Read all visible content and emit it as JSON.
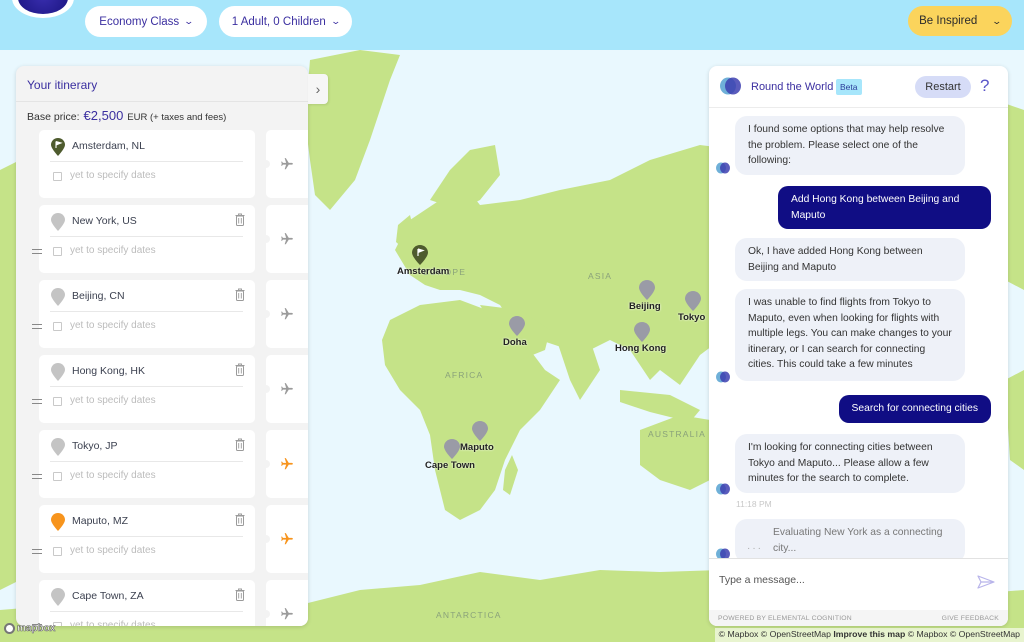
{
  "header": {
    "cabin_class": "Economy Class",
    "passengers": "1 Adult, 0 Children",
    "inspire_label": "Be Inspired"
  },
  "itinerary": {
    "title": "Your itinerary",
    "price_label": "Base price:",
    "price_amount": "€2,500",
    "price_suffix": "EUR (+ taxes and fees)",
    "toggle_icon": "chevron-right-icon",
    "stops": [
      {
        "city": "Amsterdam, NL",
        "dates": "yet to specify dates",
        "pin": "origin-flag",
        "pin_color": "#4e5b2e",
        "deletable": false,
        "leg_color": "#9b9b9b"
      },
      {
        "city": "New York, US",
        "dates": "yet to specify dates",
        "pin": "default",
        "pin_color": "#c4c4c4",
        "deletable": true,
        "leg_color": "#9b9b9b"
      },
      {
        "city": "Beijing, CN",
        "dates": "yet to specify dates",
        "pin": "default",
        "pin_color": "#c4c4c4",
        "deletable": true,
        "leg_color": "#9b9b9b"
      },
      {
        "city": "Hong Kong, HK",
        "dates": "yet to specify dates",
        "pin": "default",
        "pin_color": "#c4c4c4",
        "deletable": true,
        "leg_color": "#9b9b9b"
      },
      {
        "city": "Tokyo, JP",
        "dates": "yet to specify dates",
        "pin": "default",
        "pin_color": "#c4c4c4",
        "deletable": true,
        "leg_color": "#f7941d"
      },
      {
        "city": "Maputo, MZ",
        "dates": "yet to specify dates",
        "pin": "highlight",
        "pin_color": "#f7941d",
        "deletable": true,
        "leg_color": "#f7941d"
      },
      {
        "city": "Cape Town, ZA",
        "dates": "yet to specify dates",
        "pin": "default",
        "pin_color": "#c4c4c4",
        "deletable": true,
        "leg_color": "#9b9b9b"
      }
    ]
  },
  "map": {
    "region_labels": [
      "EUROPE",
      "ASIA",
      "AFRICA",
      "AUSTRALIA",
      "ANTARCTICA"
    ],
    "markers": [
      {
        "name": "Amsterdam",
        "type": "origin"
      },
      {
        "name": "Doha",
        "type": "default"
      },
      {
        "name": "Beijing",
        "type": "default"
      },
      {
        "name": "Tokyo",
        "type": "default"
      },
      {
        "name": "Hong Kong",
        "type": "default"
      },
      {
        "name": "Maputo",
        "type": "default"
      },
      {
        "name": "Cape Town",
        "type": "default"
      }
    ],
    "logo": "mapbox",
    "attribution": {
      "part1": "© Mapbox © OpenStreetMap",
      "improve": "Improve this map",
      "part2": "© Mapbox © OpenStreetMap"
    },
    "colors": {
      "land": "#c5e388",
      "water": "#e9f8fe"
    }
  },
  "chat": {
    "title": "Round the World",
    "badge": "Beta",
    "restart_label": "Restart",
    "help_label": "?",
    "messages": [
      {
        "from": "bot",
        "text": "I found some options that may help resolve the problem. Please select one of the following:"
      },
      {
        "from": "user",
        "text": "Add Hong Kong between Beijing and Maputo"
      },
      {
        "from": "bot",
        "text": "Ok, I have added Hong Kong between Beijing and Maputo"
      },
      {
        "from": "bot",
        "text": "I was unable to find flights from Tokyo to Maputo, even when looking for flights with multiple legs. You can make changes to your itinerary, or I can search for connecting cities. This could take a few minutes"
      },
      {
        "from": "user",
        "text": "Search for connecting cities"
      },
      {
        "from": "bot",
        "text": "I'm looking for connecting cities between Tokyo and Maputo... Please allow a few minutes for the search to complete."
      }
    ],
    "timestamp": "11:18 PM",
    "status_message": "Evaluating New York as a connecting city...",
    "input_placeholder": "Type a message...",
    "input_value": "",
    "footer_left": "POWERED BY ELEMENTAL COGNITION",
    "footer_right": "GIVE FEEDBACK",
    "colors": {
      "accent": "#3b2fa0",
      "user_bubble": "#100d84",
      "bot_bubble": "#eef1f8"
    }
  }
}
